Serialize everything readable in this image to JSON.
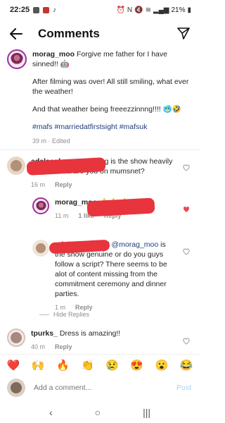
{
  "status_bar": {
    "time": "22:25",
    "battery": "21%"
  },
  "header": {
    "title": "Comments"
  },
  "caption": {
    "username": "morag_moo",
    "line1": "Forgive me father for I have sinned!! 🤖",
    "line2": "After filming was over! All still smiling, what ever the weather!",
    "line3": "And that weather being freeezzinnng!!!! 🥶🤣",
    "hashtags": "#mafs #marriedatfirstsight #mafsuk",
    "meta": "39 m · Edited"
  },
  "comments": [
    {
      "username": "adelaanhorry87",
      "text": "Morag is the show heavily scripted and are you on mumsnet?",
      "time": "16 m",
      "reply": "Reply"
    },
    {
      "username": "morag_moo",
      "text": "👍👍 👍",
      "time": "11 m",
      "likes": "1 like",
      "reply": "Reply"
    },
    {
      "username": "adelaanhorry87",
      "mention": "@morag_moo",
      "text": "is the show genuine or do you guys follow a script? There seems to be alot of content missing from the commitment ceremony and dinner parties.",
      "time": "1 m",
      "reply": "Reply"
    },
    {
      "username": "tpurks_",
      "text": "Dress is amazing!!",
      "time": "40 m",
      "reply": "Reply"
    }
  ],
  "hide_replies": "Hide Replies",
  "emojis": [
    "❤️",
    "🙌",
    "🔥",
    "👏",
    "😢",
    "😍",
    "😮",
    "😂"
  ],
  "input": {
    "placeholder": "Add a comment...",
    "post_label": "Post"
  },
  "colors": {
    "heart_liked": "#ed4956",
    "hashtag": "#1d3d78",
    "post_disabled": "#a6d1f5",
    "redaction": "#e8343d"
  }
}
